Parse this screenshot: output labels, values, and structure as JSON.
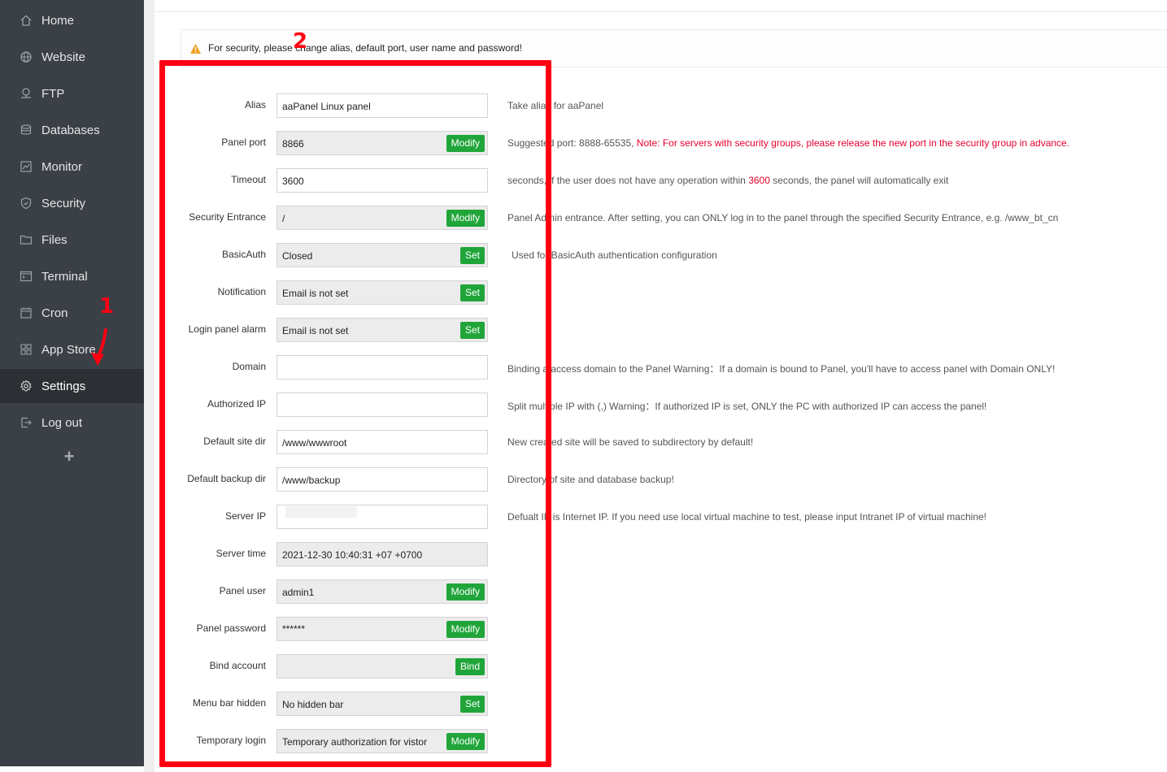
{
  "sidebar": {
    "items": [
      {
        "label": "Home",
        "icon": "home-icon"
      },
      {
        "label": "Website",
        "icon": "globe-icon"
      },
      {
        "label": "FTP",
        "icon": "ftp-icon"
      },
      {
        "label": "Databases",
        "icon": "database-icon"
      },
      {
        "label": "Monitor",
        "icon": "monitor-icon"
      },
      {
        "label": "Security",
        "icon": "shield-icon"
      },
      {
        "label": "Files",
        "icon": "folder-icon"
      },
      {
        "label": "Terminal",
        "icon": "terminal-icon"
      },
      {
        "label": "Cron",
        "icon": "calendar-icon"
      },
      {
        "label": "App Store",
        "icon": "apps-grid-icon"
      },
      {
        "label": "Settings",
        "icon": "gear-icon"
      },
      {
        "label": "Log out",
        "icon": "logout-icon"
      }
    ],
    "active": "Settings",
    "add_symbol": "+"
  },
  "alert": {
    "text": "For security, please change alias, default port, user name and password!",
    "icon": "warning-icon"
  },
  "settings": {
    "alias": {
      "label": "Alias",
      "value": "aaPanel Linux panel",
      "help": "Take alias for aaPanel"
    },
    "panel_port": {
      "label": "Panel port",
      "value": "8866",
      "button": "Modify",
      "help": "Suggested port: 8888-65535, ",
      "help_warning": "Note: For servers with security groups, please release the new port in the security group in advance."
    },
    "timeout": {
      "label": "Timeout",
      "value": "3600",
      "help_pre": "seconds, if the user does not have any operation within ",
      "help_num": "3600",
      "help_post": " seconds, the panel will automatically exit"
    },
    "security_entrance": {
      "label": "Security Entrance",
      "value": "/",
      "button": "Modify",
      "help": "Panel Admin entrance. After setting, you can ONLY log in to the panel through the specified Security Entrance, e.g. /www_bt_cn"
    },
    "basic_auth": {
      "label": "BasicAuth",
      "value": "Closed",
      "button": "Set",
      "help": "Used for BasicAuth authentication configuration"
    },
    "notification": {
      "label": "Notification",
      "value": "Email is not set",
      "button": "Set"
    },
    "login_alarm": {
      "label": "Login panel alarm",
      "value": "Email is not set",
      "button": "Set"
    },
    "domain": {
      "label": "Domain",
      "value": "",
      "help": "Binding a access domain to the Panel Warning：If a domain is bound to Panel, you'll have to access panel with Domain ONLY!"
    },
    "authorized_ip": {
      "label": "Authorized IP",
      "value": "",
      "help": "Split multiple IP with (,) Warning：If authorized IP is set, ONLY the PC with authorized IP can access the panel!"
    },
    "default_site_dir": {
      "label": "Default site dir",
      "value": "/www/wwwroot",
      "help": "New created site will be saved to subdirectory by default!"
    },
    "default_backup_dir": {
      "label": "Default backup dir",
      "value": "/www/backup",
      "help": "Directory of site and database backup!"
    },
    "server_ip": {
      "label": "Server IP",
      "value": "",
      "help": "Defualt IP is Internet IP. If you need use local virtual machine to test, please input Intranet IP of virtual machine!"
    },
    "server_time": {
      "label": "Server time",
      "value": "2021-12-30 10:40:31 +07 +0700"
    },
    "panel_user": {
      "label": "Panel user",
      "value": "admin1",
      "button": "Modify"
    },
    "panel_password": {
      "label": "Panel password",
      "value": "******",
      "button": "Modify"
    },
    "bind_account": {
      "label": "Bind account",
      "value": "",
      "button": "Bind"
    },
    "menu_bar_hidden": {
      "label": "Menu bar hidden",
      "value": "No hidden bar",
      "button": "Set"
    },
    "temporary_login": {
      "label": "Temporary login",
      "value": "Temporary authorization for vistor",
      "button": "Modify"
    }
  },
  "annotations": {
    "step1": "1",
    "step2": "2"
  },
  "colors": {
    "sidebar_bg": "#3a4045",
    "sidebar_active": "#2c3034",
    "button_green": "#20a53a",
    "warning_red": "#e8002d",
    "annotation_red": "#ff0013"
  }
}
